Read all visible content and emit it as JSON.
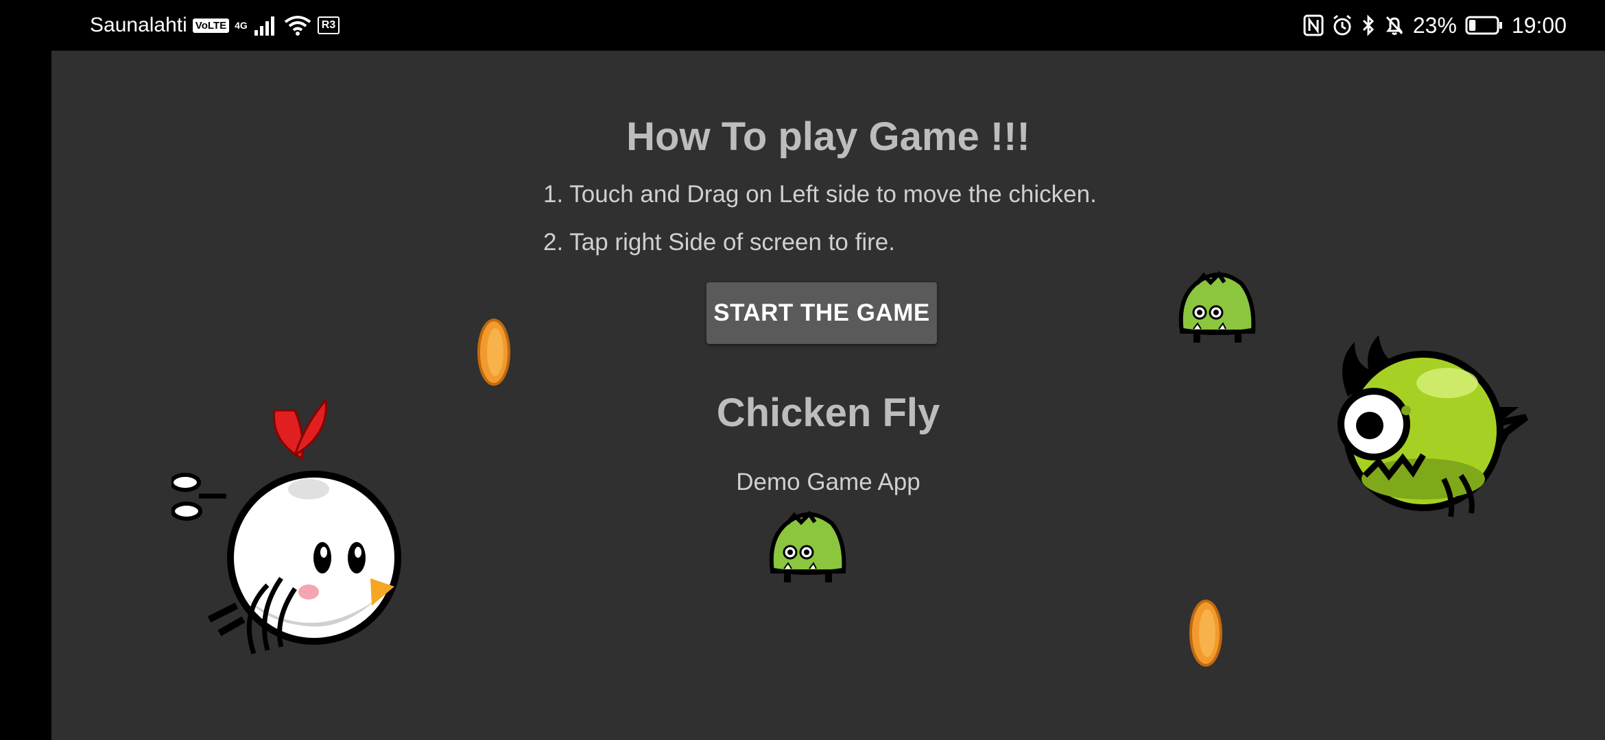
{
  "status_bar": {
    "carrier": "Saunalahti",
    "volte_label": "VoLTE",
    "network_label": "4G",
    "extra_label": "R3",
    "battery_percent": "23%",
    "time": "19:00",
    "battery_level": 0.23,
    "icons": [
      "volte-icon",
      "signal-icon",
      "wifi-icon",
      "nfc-icon",
      "alarm-icon",
      "bluetooth-icon",
      "mute-icon",
      "battery-icon"
    ]
  },
  "game": {
    "instructions": {
      "title": "How To play Game !!!",
      "steps": [
        "1. Touch and Drag on Left side to move the chicken.",
        "2. Tap right Side of screen to fire."
      ]
    },
    "start_button_label": "START THE GAME",
    "app_name": "Chicken Fly",
    "subtitle": "Demo Game App",
    "colors": {
      "background": "#303030",
      "button": "#5a5a5a",
      "text": "#bdbdbd",
      "coin": "#f39a2e",
      "monster": "#8cc63f",
      "big_monster": "#a6d124"
    }
  }
}
